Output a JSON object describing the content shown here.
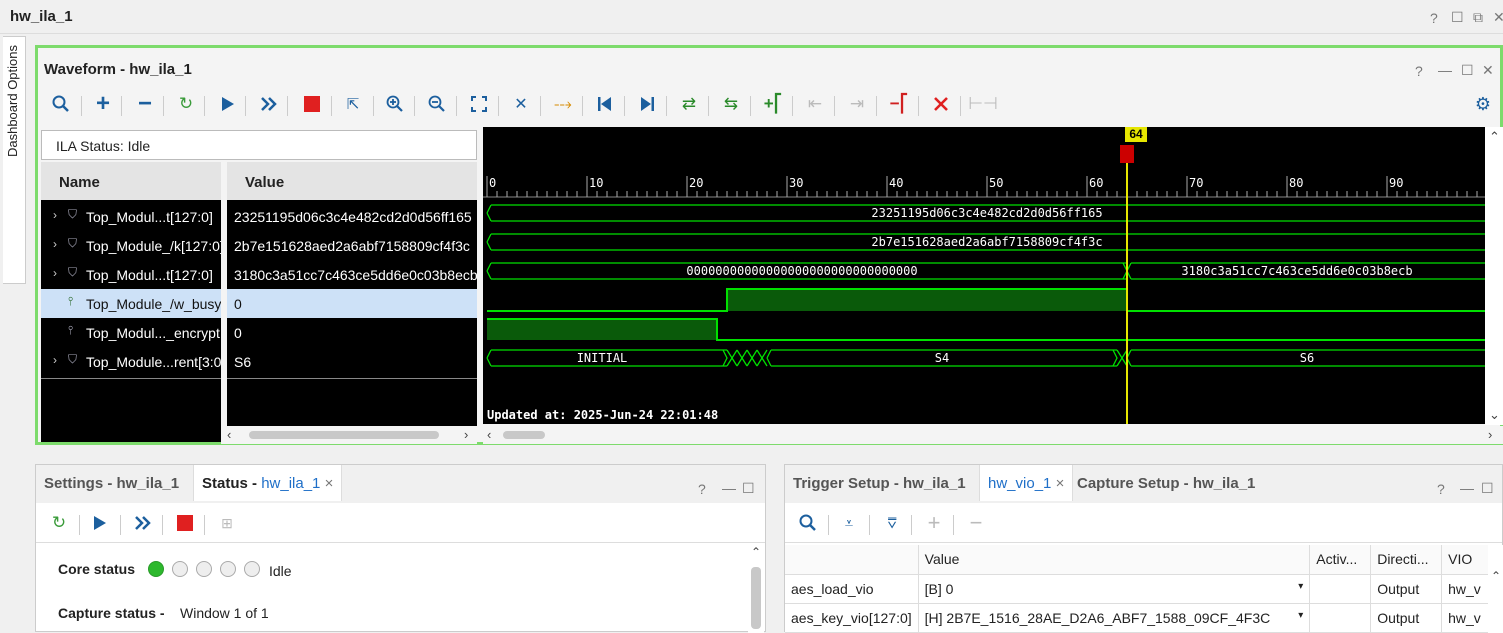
{
  "window": {
    "title": "hw_ila_1",
    "controls": [
      "?",
      "☐",
      "⧉",
      "✕"
    ]
  },
  "sidebar": {
    "label": "Dashboard Options"
  },
  "waveform": {
    "title": "Waveform - hw_ila_1",
    "controls": [
      "?",
      "—",
      "☐",
      "✕"
    ],
    "ila_status": "ILA Status: Idle",
    "col_name": "Name",
    "col_value": "Value",
    "signals": [
      {
        "name": "Top_Modul...t[127:0]",
        "value": "23251195d06c3c4e482cd2d0d56ff165",
        "expand": true,
        "bus": true
      },
      {
        "name": "Top_Module_/k[127:0]",
        "value": "2b7e151628aed2a6abf7158809cf4f3c",
        "expand": true,
        "bus": true
      },
      {
        "name": "Top_Modul...t[127:0]",
        "value": "3180c3a51cc7c463ce5dd6e0c03b8ecb",
        "expand": true,
        "bus": true
      },
      {
        "name": "Top_Module_/w_busy",
        "value": "0",
        "expand": false,
        "bus": false
      },
      {
        "name": "Top_Modul..._encrypt",
        "value": "0",
        "expand": false,
        "bus": false
      },
      {
        "name": "Top_Module...rent[3:0]",
        "value": "S6",
        "expand": true,
        "bus": true
      }
    ],
    "cursor": "64",
    "axis_ticks": [
      "0",
      "10",
      "20",
      "30",
      "40",
      "50",
      "60",
      "70",
      "80",
      "90"
    ],
    "bus_labels": {
      "row1": "23251195d06c3c4e482cd2d0d56ff165",
      "row2": "2b7e151628aed2a6abf7158809cf4f3c",
      "row3a": "00000000000000000000000000000000",
      "row3b": "3180c3a51cc7c463ce5dd6e0c03b8ecb",
      "row6a": "INITIAL",
      "row6b": "S4",
      "row6c": "S6"
    },
    "updated": "Updated at: 2025-Jun-24 22:01:48",
    "colors": {
      "accent": "#7ddb6c",
      "wave": "#00e000",
      "cursor": "#e6e600",
      "marker": "#cc0000"
    }
  },
  "bottom_left": {
    "tabs": [
      {
        "bold": "Settings - hw_ila_1",
        "blue": ""
      },
      {
        "bold": "Status - ",
        "blue": "hw_ila_1"
      }
    ],
    "controls": [
      "?",
      "—",
      "☐"
    ],
    "core_status_label": "Core status",
    "core_status_value": "Idle",
    "capture_label": "Capture status -",
    "capture_value": "Window 1 of 1"
  },
  "bottom_right": {
    "tabs": [
      {
        "bold": "Trigger Setup - hw_ila_1",
        "blue": ""
      },
      {
        "bold": "",
        "blue": "hw_vio_1"
      },
      {
        "bold": "Capture Setup - hw_ila_1",
        "blue": ""
      }
    ],
    "controls": [
      "?",
      "—",
      "☐"
    ],
    "columns": [
      "",
      "Value",
      "Activ...",
      "Directi...",
      "VIO"
    ],
    "rows": [
      {
        "name": "aes_load_vio",
        "value": "[B] 0",
        "activity": "",
        "direction": "Output",
        "vio": "hw_v"
      },
      {
        "name": "aes_key_vio[127:0]",
        "value": "[H] 2B7E_1516_28AE_D2A6_ABF7_1588_09CF_4F3C",
        "activity": "",
        "direction": "Output",
        "vio": "hw_v"
      }
    ]
  }
}
